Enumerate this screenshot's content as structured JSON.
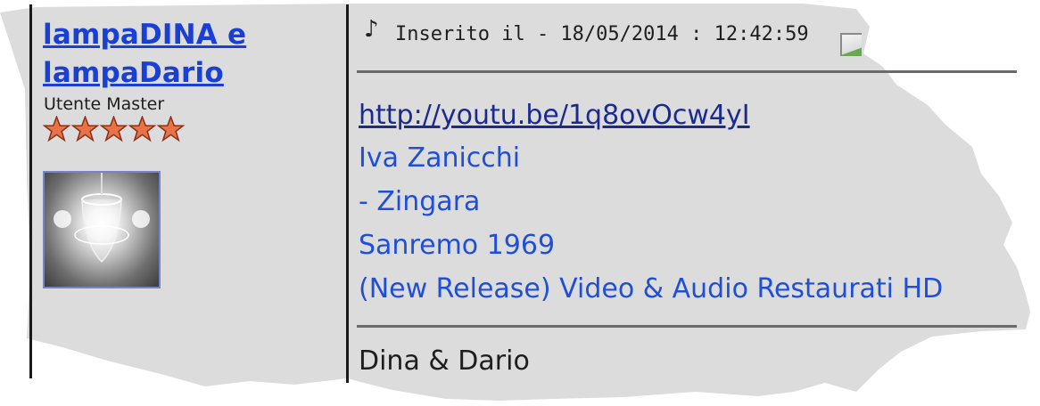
{
  "user": {
    "name_line1": "lampaDINA e",
    "name_line2": "lampaDario",
    "rank": "Utente Master",
    "stars": 5
  },
  "post": {
    "posted_label": "Inserito il - 18/05/2014 : 12:42:59",
    "link": "http://youtu.be/1q8ovOcw4yI",
    "lines": [
      "Iva Zanicchi",
      "- Zingara",
      "Sanremo 1969",
      "(New Release) Video & Audio Restaurati HD"
    ],
    "signature": "Dina & Dario"
  },
  "colors": {
    "background": "#dcdcdc",
    "username": "#1a3fd4",
    "message_text": "#1f4fd6",
    "link": "#1b2a8f",
    "star": "#e8734a"
  },
  "icons": [
    "music-note-icon",
    "star-icon",
    "post-icon"
  ]
}
